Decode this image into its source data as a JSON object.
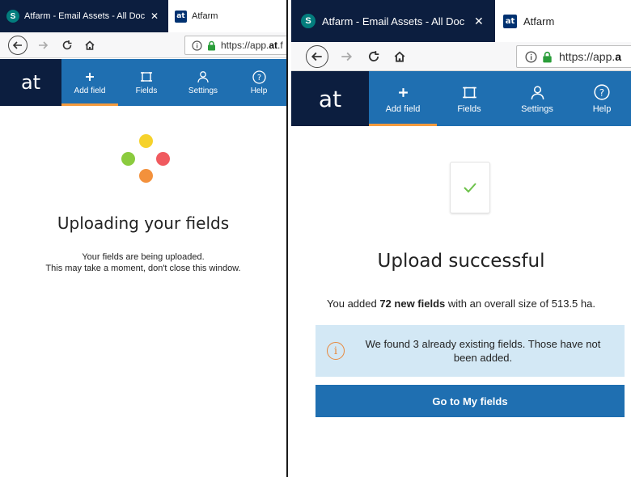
{
  "left": {
    "tabs": {
      "inactive": {
        "favicon": "S",
        "title": "Atfarm - Email Assets - All Doc",
        "close": "✕"
      },
      "active": {
        "favicon": "at",
        "title": "Atfarm"
      }
    },
    "toolbar": {
      "url_prefix": "https://app.",
      "url_bold": "at",
      "url_suffix": ".f"
    },
    "app_nav": {
      "logo": "at",
      "items": [
        {
          "label": "Add field",
          "icon": "plus-icon",
          "active": true
        },
        {
          "label": "Fields",
          "icon": "field-frame-icon",
          "active": false
        },
        {
          "label": "Settings",
          "icon": "user-icon",
          "active": false
        },
        {
          "label": "Help",
          "icon": "help-icon",
          "active": false
        }
      ]
    },
    "loader": {
      "colors": [
        "#f6d22b",
        "#8bcb3e",
        "#f05a5f",
        "#f3913c"
      ]
    },
    "heading": "Uploading your fields",
    "message_line1": "Your fields are being uploaded.",
    "message_line2": "This may take a moment, don't close this window."
  },
  "right": {
    "tabs": {
      "inactive": {
        "favicon": "S",
        "title": "Atfarm - Email Assets - All Doc",
        "close": "✕"
      },
      "active": {
        "favicon": "at",
        "title": "Atfarm"
      }
    },
    "toolbar": {
      "url_prefix": "https://app.",
      "url_bold": "a",
      "url_suffix": ""
    },
    "app_nav": {
      "logo": "at",
      "items": [
        {
          "label": "Add field",
          "icon": "plus-icon",
          "active": true
        },
        {
          "label": "Fields",
          "icon": "field-frame-icon",
          "active": false
        },
        {
          "label": "Settings",
          "icon": "user-icon",
          "active": false
        },
        {
          "label": "Help",
          "icon": "help-icon",
          "active": false
        }
      ]
    },
    "heading": "Upload successful",
    "summary": {
      "prefix": "You added ",
      "bold": "72 new fields",
      "suffix": " with an overall size of 513.5 ha."
    },
    "notice": {
      "icon": "info-icon",
      "text": "We found 3 already existing fields. Those have not been added."
    },
    "button": "Go to My fields"
  },
  "colors": {
    "nav_blue": "#1f6fb1",
    "logo_navy": "#0c1e3f",
    "active_underline": "#f39a3e",
    "notice_bg": "#d3e8f5",
    "check_green": "#6cc24a"
  }
}
